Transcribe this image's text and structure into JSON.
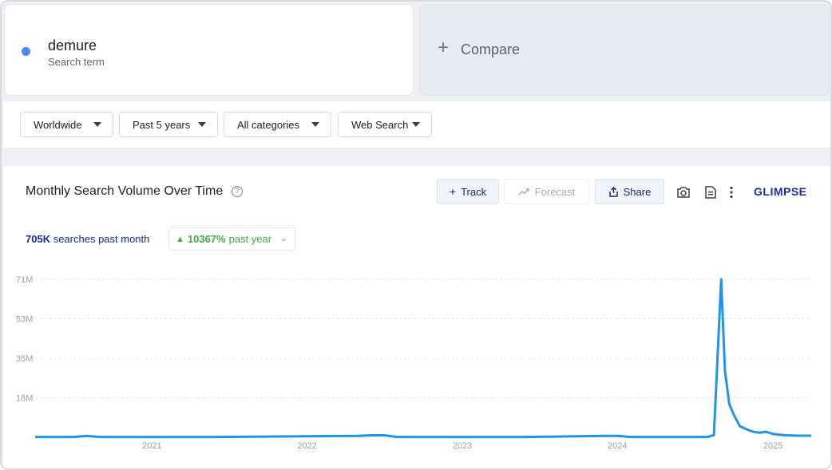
{
  "term": {
    "name": "demure",
    "subtitle": "Search term",
    "dot_color": "#4f87f0"
  },
  "compare": {
    "icon": "plus-icon",
    "label": "Compare"
  },
  "filters": [
    {
      "label": "Worldwide"
    },
    {
      "label": "Past 5 years"
    },
    {
      "label": "All categories"
    },
    {
      "label": "Web Search"
    }
  ],
  "chart_header": {
    "title": "Monthly Search Volume Over Time",
    "track_label": "Track",
    "forecast_label": "Forecast",
    "share_label": "Share",
    "brand": "GLIMPSE",
    "icons": [
      "help-icon",
      "camera-icon",
      "csv-icon",
      "more-vert-icon"
    ]
  },
  "stats": {
    "volume_value": "705K",
    "volume_text": "searches past month",
    "growth_value": "10367%",
    "growth_text": "past year",
    "growth_color": "#42a844"
  },
  "chart_data": {
    "type": "line",
    "title": "",
    "xlabel": "",
    "ylabel": "",
    "x_tick_labels": [
      "2021",
      "2022",
      "2023",
      "2024",
      "2025"
    ],
    "y_tick_labels": [
      "18M",
      "35M",
      "53M",
      "71M"
    ],
    "y_ticks": [
      17750000,
      35500000,
      53250000,
      71000000
    ],
    "ylim": [
      0,
      71000000
    ],
    "xlim": [
      "2020-04-01",
      "2025-04-01"
    ],
    "grid": true,
    "line_color": "#1f94e8",
    "series": [
      {
        "x": [
          "2020-04-01",
          "2020-07-01",
          "2020-08-01",
          "2020-09-01",
          "2021-06-01",
          "2022-05-01",
          "2022-06-01",
          "2022-07-01",
          "2022-08-01",
          "2023-06-01",
          "2023-12-01",
          "2024-01-01",
          "2024-02-01",
          "2024-06-01",
          "2024-08-01",
          "2024-08-15",
          "2024-09-01",
          "2024-09-10",
          "2024-09-20",
          "2024-10-01",
          "2024-10-15",
          "2024-11-01",
          "2024-11-15",
          "2024-12-01",
          "2024-12-15",
          "2025-01-01",
          "2025-01-15",
          "2025-02-01",
          "2025-03-01",
          "2025-04-01"
        ],
        "values": [
          150000,
          150000,
          600000,
          150000,
          150000,
          600000,
          900000,
          900000,
          150000,
          150000,
          600000,
          600000,
          150000,
          150000,
          150000,
          1000000,
          71000000,
          30000000,
          15000000,
          10000000,
          5000000,
          3500000,
          2500000,
          2000000,
          2500000,
          1500000,
          1200000,
          900000,
          705000,
          705000
        ]
      }
    ]
  }
}
